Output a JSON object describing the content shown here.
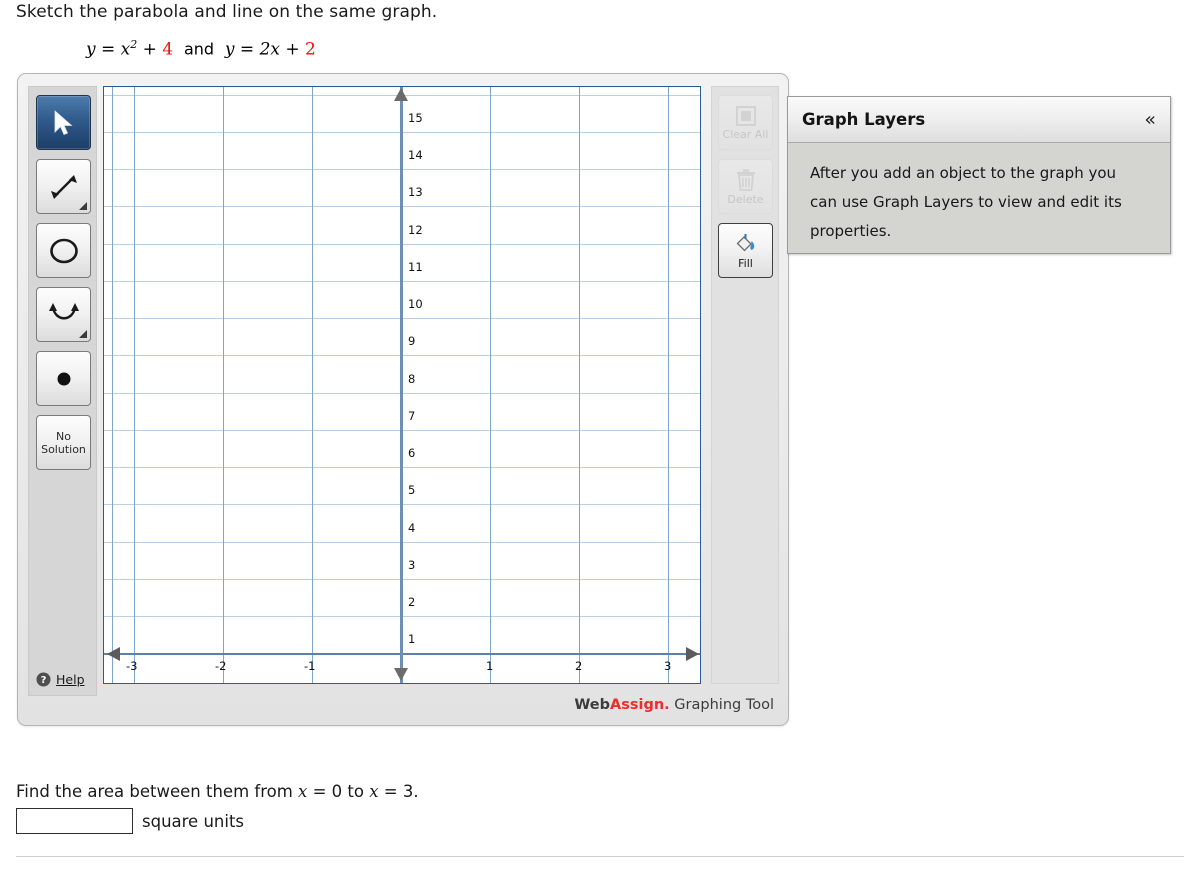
{
  "question": {
    "prompt": "Sketch the parabola and line on the same graph.",
    "equation": {
      "lhs1": "y",
      "eq1": " = ",
      "base1": "x",
      "exp1": "2",
      "plus1": " + ",
      "const1": "4",
      "conjunction": "and",
      "lhs2": "y",
      "eq2": " = ",
      "coef2": "2x",
      "plus2": " + ",
      "const2": "2"
    },
    "sub_prompt": "Find the area between them from x = 0 to x = 3.",
    "answer_value": "",
    "answer_placeholder": "",
    "answer_units": "square units"
  },
  "toolbar": {
    "tools": [
      {
        "name": "select-tool",
        "icon": "cursor-arrow-icon",
        "selected": true,
        "has_corner": false
      },
      {
        "name": "line-tool",
        "icon": "double-arrow-line-icon",
        "selected": false,
        "has_corner": true
      },
      {
        "name": "circle-tool",
        "icon": "circle-outline-icon",
        "selected": false,
        "has_corner": false
      },
      {
        "name": "parabola-tool",
        "icon": "parabola-icon",
        "selected": false,
        "has_corner": true
      },
      {
        "name": "point-tool",
        "icon": "filled-dot-icon",
        "selected": false,
        "has_corner": false
      }
    ],
    "no_solution_line1": "No",
    "no_solution_line2": "Solution",
    "help_label": "Help",
    "help_icon": "question-mark-circle-icon"
  },
  "actions": [
    {
      "name": "clear-all-button",
      "label": "Clear All",
      "icon": "square-clear-icon",
      "enabled": false
    },
    {
      "name": "delete-button",
      "label": "Delete",
      "icon": "trash-can-icon",
      "enabled": false
    },
    {
      "name": "fill-button",
      "label": "Fill",
      "icon": "paint-bucket-icon",
      "enabled": true
    }
  ],
  "brand": {
    "web": "Web",
    "assign": "Assign.",
    "tool": " Graphing Tool"
  },
  "layers": {
    "title": "Graph Layers",
    "collapse_icon": "double-chevron-left-icon",
    "body_line1": "After you add an object to the graph you",
    "body_line2": "can use Graph Layers to view and edit its",
    "body_line3": "properties."
  },
  "chart_data": {
    "type": "line",
    "title": "",
    "xlabel": "",
    "ylabel": "",
    "xlim": [
      -3.62,
      3.1
    ],
    "ylim": [
      -0.55,
      15.5
    ],
    "grid": true,
    "legend": "none",
    "x_ticks": [
      -3,
      -2,
      -1,
      1,
      2,
      3
    ],
    "y_ticks": [
      1,
      2,
      3,
      4,
      5,
      6,
      7,
      8,
      9,
      10,
      11,
      12,
      13,
      14,
      15
    ],
    "x_gridlines": [
      -3.5,
      -3,
      -2,
      -1,
      0,
      1,
      2,
      3
    ],
    "y_gridlines": [
      1,
      2,
      3,
      4,
      5,
      6,
      7,
      8,
      9,
      10,
      11,
      12,
      13,
      14,
      15
    ],
    "series": [],
    "annotations": []
  },
  "colors": {
    "accent_red": "#e8120b",
    "grid_minor": "#b9cfe4",
    "grid_major": "#7fa5ca",
    "axis": "#5e82a6",
    "canvas_border": "#2c5a93",
    "selected_tool": "#2f5b8c",
    "brand_red": "#ef2b2b"
  }
}
